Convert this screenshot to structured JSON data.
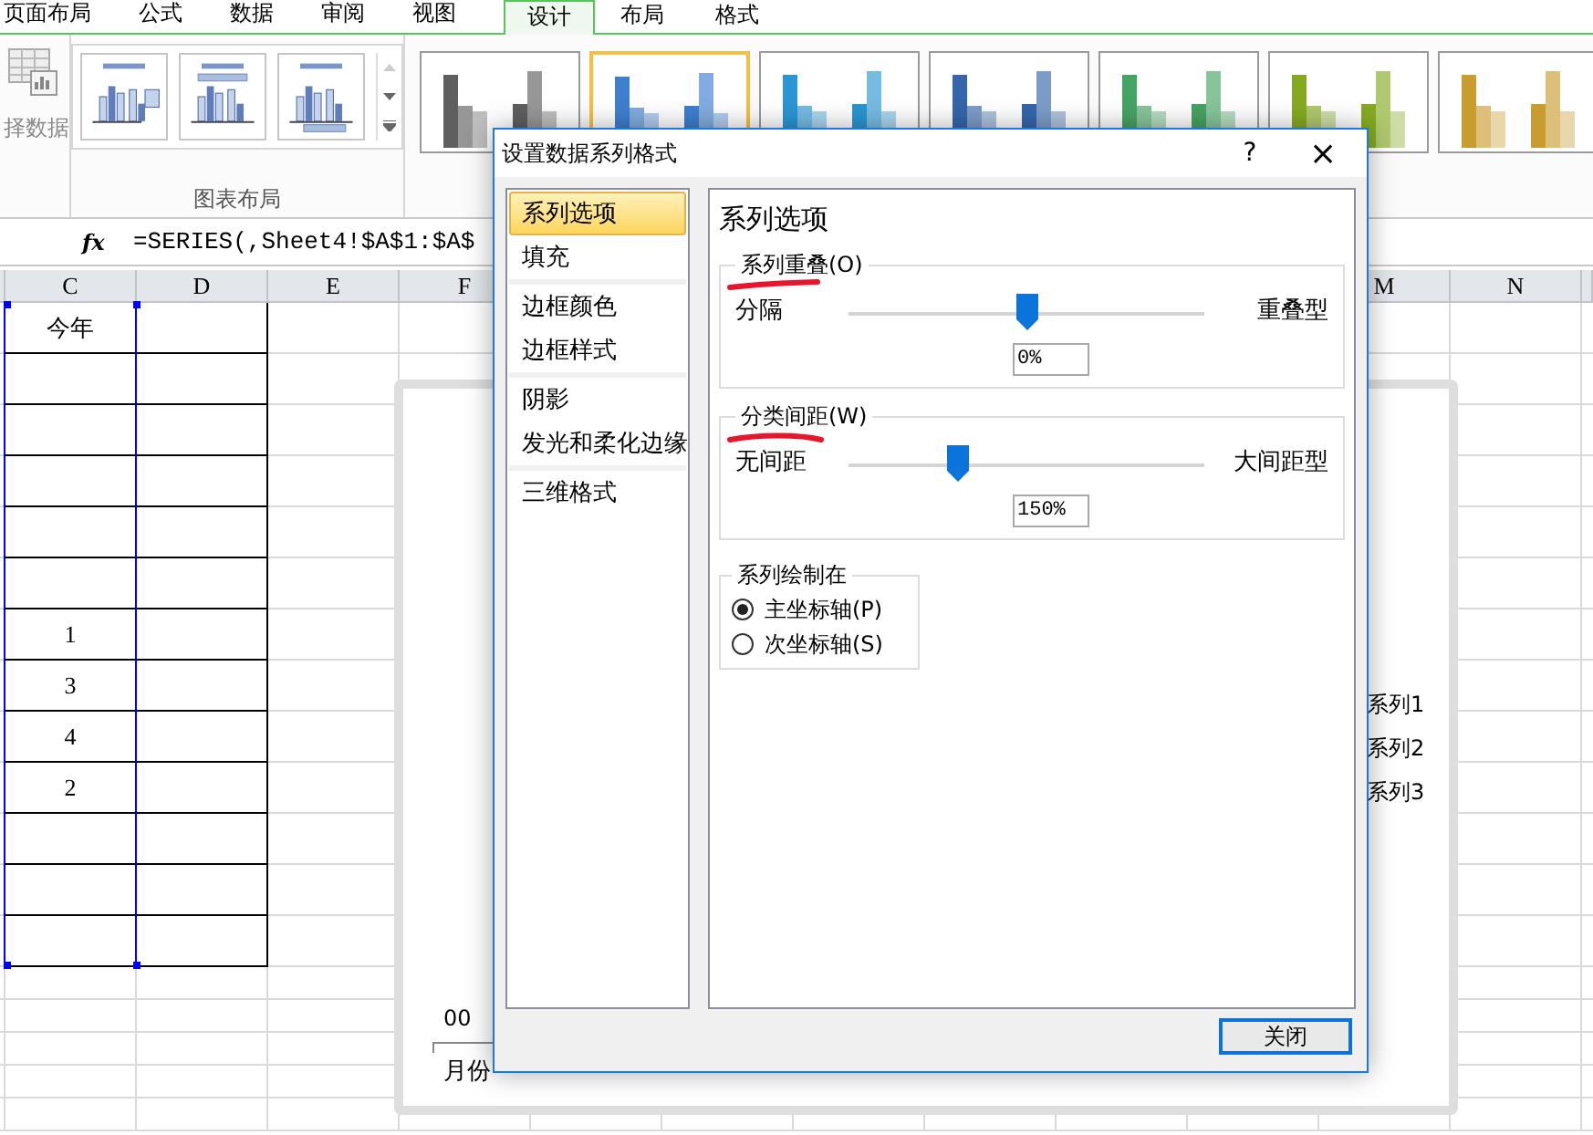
{
  "ribbon_tabs": [
    {
      "label": "页面布局",
      "selected": false
    },
    {
      "label": "公式",
      "selected": false
    },
    {
      "label": "数据",
      "selected": false
    },
    {
      "label": "审阅",
      "selected": false
    },
    {
      "label": "视图",
      "selected": false
    },
    {
      "label": "设计",
      "selected": true
    },
    {
      "label": "布局",
      "selected": false
    },
    {
      "label": "格式",
      "selected": false
    }
  ],
  "ribbon": {
    "select_data_label": "择数据",
    "layout_group_label": "图表布局",
    "chart_styles": [
      {
        "color": "#5f5f5f",
        "selected": false
      },
      {
        "color": "#3e7fce",
        "selected": true
      },
      {
        "color": "#2a96d3",
        "selected": false
      },
      {
        "color": "#3566ab",
        "selected": false
      },
      {
        "color": "#46a463",
        "selected": false
      },
      {
        "color": "#85aa22",
        "selected": false
      },
      {
        "color": "#c99c30",
        "selected": false
      }
    ]
  },
  "formula_bar": {
    "function_label": "fx",
    "value": "=SERIES(,Sheet4!$A$1:$A$"
  },
  "sheet": {
    "column_headers_left": [
      "C",
      "D",
      "E",
      "F"
    ],
    "column_headers_right": [
      "M",
      "N"
    ],
    "table_rows": [
      {
        "c": "今年"
      },
      {},
      {},
      {},
      {},
      {},
      {
        "c": "1"
      },
      {
        "c": "3"
      },
      {
        "c": "4"
      },
      {
        "c": "2"
      },
      {},
      {},
      {}
    ]
  },
  "chart": {
    "y_tick_label": "00",
    "x_axis_label": "月份",
    "legend": [
      "系列1",
      "系列2",
      "系列3"
    ]
  },
  "dialog": {
    "title": "设置数据系列格式",
    "help": "?",
    "close": "×",
    "nav_groups": [
      [
        {
          "label": "系列选项",
          "selected": true
        },
        {
          "label": "填充",
          "selected": false
        }
      ],
      [
        {
          "label": "边框颜色",
          "selected": false
        },
        {
          "label": "边框样式",
          "selected": false
        }
      ],
      [
        {
          "label": "阴影",
          "selected": false
        },
        {
          "label": "发光和柔化边缘",
          "selected": false
        }
      ],
      [
        {
          "label": "三维格式",
          "selected": false
        }
      ]
    ],
    "heading": "系列选项",
    "sliders": [
      {
        "title": "系列重叠(O)",
        "left": "分隔",
        "right": "重叠型",
        "level": 0.5,
        "value": "0%"
      },
      {
        "title": "分类间距(W)",
        "left": "无间距",
        "right": "大间距型",
        "level": 0.31,
        "value": "150%"
      }
    ],
    "plot_on": {
      "title": "系列绘制在",
      "options": [
        {
          "label": "主坐标轴(P)",
          "selected": true
        },
        {
          "label": "次坐标轴(S)",
          "selected": false
        }
      ]
    },
    "close_button": "关闭"
  }
}
